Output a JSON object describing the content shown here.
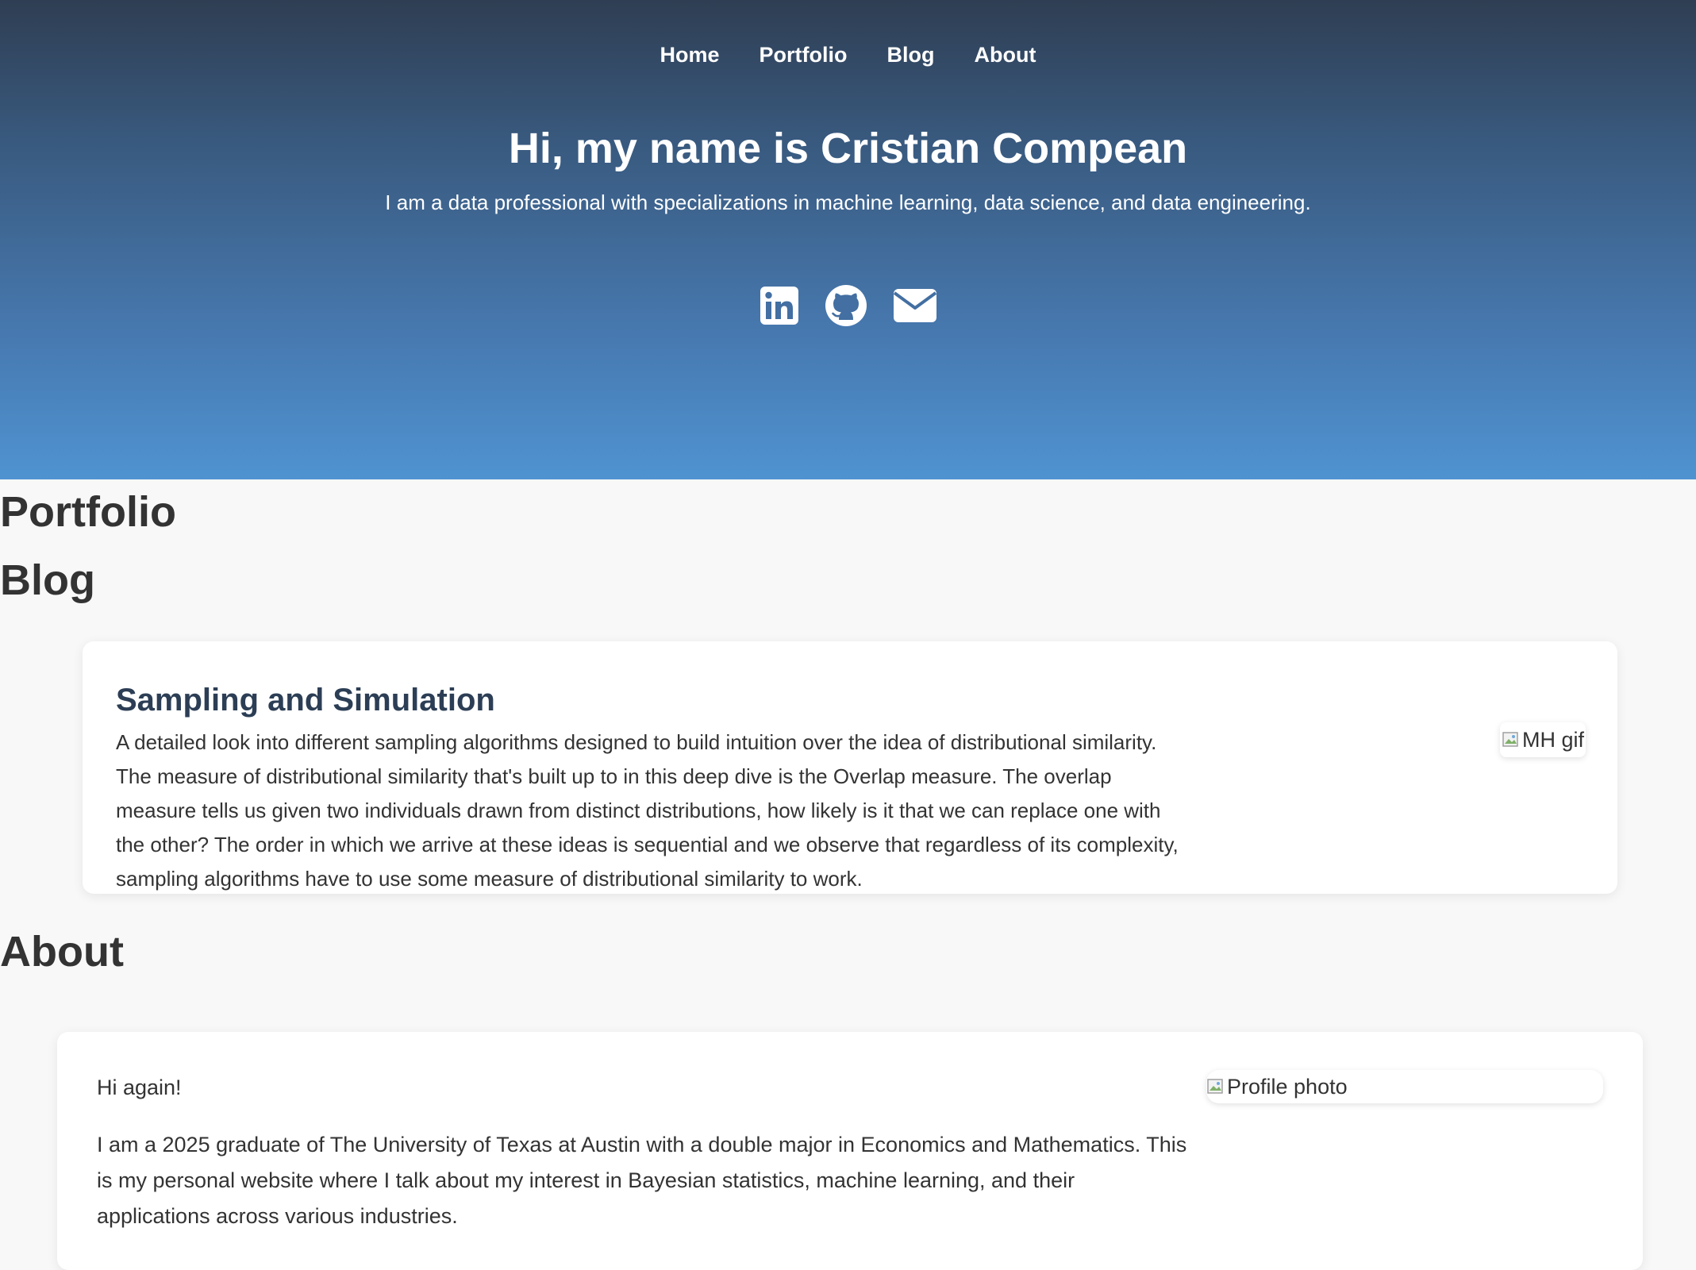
{
  "nav": {
    "items": [
      "Home",
      "Portfolio",
      "Blog",
      "About"
    ]
  },
  "hero": {
    "title": "Hi, my name is Cristian Compean",
    "subtitle": "I am a data professional with specializations in machine learning, data science, and data engineering.",
    "social": [
      "linkedin-icon",
      "github-icon",
      "mail-icon"
    ]
  },
  "sections": {
    "portfolio": "Portfolio",
    "blog": "Blog",
    "about": "About"
  },
  "blog": {
    "posts": [
      {
        "title": "Sampling and Simulation",
        "description": "A detailed look into different sampling algorithms designed to build intuition over the idea of distributional similarity. The measure of distributional similarity that's built up to in this deep dive is the Overlap measure. The overlap measure tells us given two individuals drawn from distinct distributions, how likely is it that we can replace one with the other? The order in which we arrive at these ideas is sequential and we observe that regardless of its complexity, sampling algorithms have to use some measure of distributional similarity to work.",
        "image_alt": "MH gif"
      }
    ]
  },
  "about": {
    "greeting": "Hi again!",
    "paragraph": "I am a 2025 graduate of The University of Texas at Austin with a double major in Economics and Mathematics. This is my personal website where I talk about my interest in Bayesian statistics, machine learning, and their applications across various industries.",
    "image_alt": "Profile photo"
  },
  "colors": {
    "hero_top": "#2f3e53",
    "hero_bottom": "#4f93d1",
    "blog_title": "#2c3e55",
    "page_bg": "#f8f8f8"
  }
}
